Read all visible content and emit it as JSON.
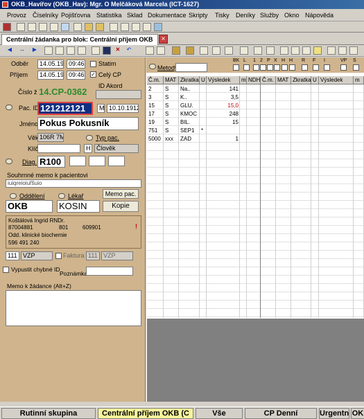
{
  "window": {
    "title": "OKB_Havířov (OKB_Hav): Mgr. O Melčáková Marcela (ICT-1627)"
  },
  "menu": [
    "Provoz",
    "Číselníky",
    "Pojišťovna",
    "Statistika",
    "Sklad",
    "Dokumentace",
    "Skripty",
    "Tisky",
    "Deníky",
    "Služby",
    "Okno",
    "Nápověda"
  ],
  "tab": {
    "label": "Centrální žádanka pro blok: Centrální příjem OKB",
    "close": "×"
  },
  "form": {
    "odber_label": "Odběr",
    "odber_date": "14.05.19",
    "odber_time": "09:46",
    "prijem_label": "Příjem",
    "prijem_date": "14.05.19",
    "prijem_time": "09:46",
    "statim_label": "Statim",
    "celycp_label": "Celý CP",
    "celycp_check": "✓",
    "cislo_label": "Číslo ž.",
    "cislo_value": "14.CP-0362",
    "idakord_label": "ID Akord",
    "pacid_label": "Pac. ID",
    "pacid_value": "121212121",
    "sex": "M",
    "birth": "10.10.1912",
    "jmeno_label": "Jméno",
    "jmeno_value": "Pokus Pokusník",
    "vek_label": "Věk",
    "vek_value": "106R 7M",
    "typpac_label": "Typ pac.",
    "klic_label": "Klíč",
    "typ_code": "H",
    "typ_value": "Člověk",
    "diag_label": "Diag.",
    "diag_value": "R100",
    "memo_pac_label": "Souhrnné memo k pacientovi",
    "memo_pac_value": "iuiqreioiuřšuio",
    "oddeleni_label": "Oddělení",
    "lekar_label": "Lékař",
    "memo_btn": "Memo pac.",
    "oddeleni_value": "OKB",
    "lekar_value": "KOSIN",
    "kopie_btn": "Kopie",
    "doctor_lines": [
      "Koštálová Ingrid RNDr.",
      "87004881",
      "801",
      "609901",
      "Odd. klinické biochemie",
      "596 491 240"
    ],
    "doctor_mark": "!",
    "insurance_code": "111",
    "insurance_type": "VZP",
    "faktura_label": "Faktura",
    "faktura_code": "111",
    "faktura_type": "VZP",
    "vypustit_label": "Vypustit chybné ID",
    "poznamka_label": "Poznámka",
    "memo_zadanka_label": "Memo k žádance (Alt+Z)"
  },
  "metody": {
    "label": "Metody",
    "flags": [
      "BK",
      "L",
      "1",
      "2",
      "P",
      "X",
      "H",
      "H",
      "R",
      "F",
      "I",
      "VP",
      "S"
    ]
  },
  "grid": {
    "headers": [
      "Č.m.",
      "MAT",
      "Zkratka",
      "U",
      "Výsledek",
      "m",
      "NDH",
      "Č.m.",
      "MAT",
      "Zkratka",
      "U",
      "Výsledek",
      "m"
    ],
    "rows": [
      {
        "cm": "2",
        "mat": "S",
        "zk": "Na..",
        "u": "",
        "val": "141",
        "red": false
      },
      {
        "cm": "3",
        "mat": "S",
        "zk": "K..",
        "u": "",
        "val": "3,5",
        "red": false
      },
      {
        "cm": "15",
        "mat": "S",
        "zk": "GLU.",
        "u": "",
        "val": "15,0",
        "red": true
      },
      {
        "cm": "17",
        "mat": "S",
        "zk": "KMOC",
        "u": "",
        "val": "248",
        "red": false
      },
      {
        "cm": "19",
        "mat": "S",
        "zk": "BIL.",
        "u": "",
        "val": "15",
        "red": false
      },
      {
        "cm": "751",
        "mat": "S",
        "zk": "SEP1",
        "u": "*",
        "val": "",
        "red": false
      },
      {
        "cm": "5000",
        "mat": "xxx",
        "zk": "ZAD",
        "u": "",
        "val": "1",
        "red": false
      }
    ]
  },
  "status": [
    "Rutinní skupina",
    "Centrální příjem OKB (C",
    "Vše",
    "CP Denní",
    "Urgentní",
    "OK"
  ],
  "colors": {
    "accent": "#f5f39a",
    "panel": "#cfb48d",
    "green_value": "#2e8b2e",
    "red_value": "#c00000"
  }
}
